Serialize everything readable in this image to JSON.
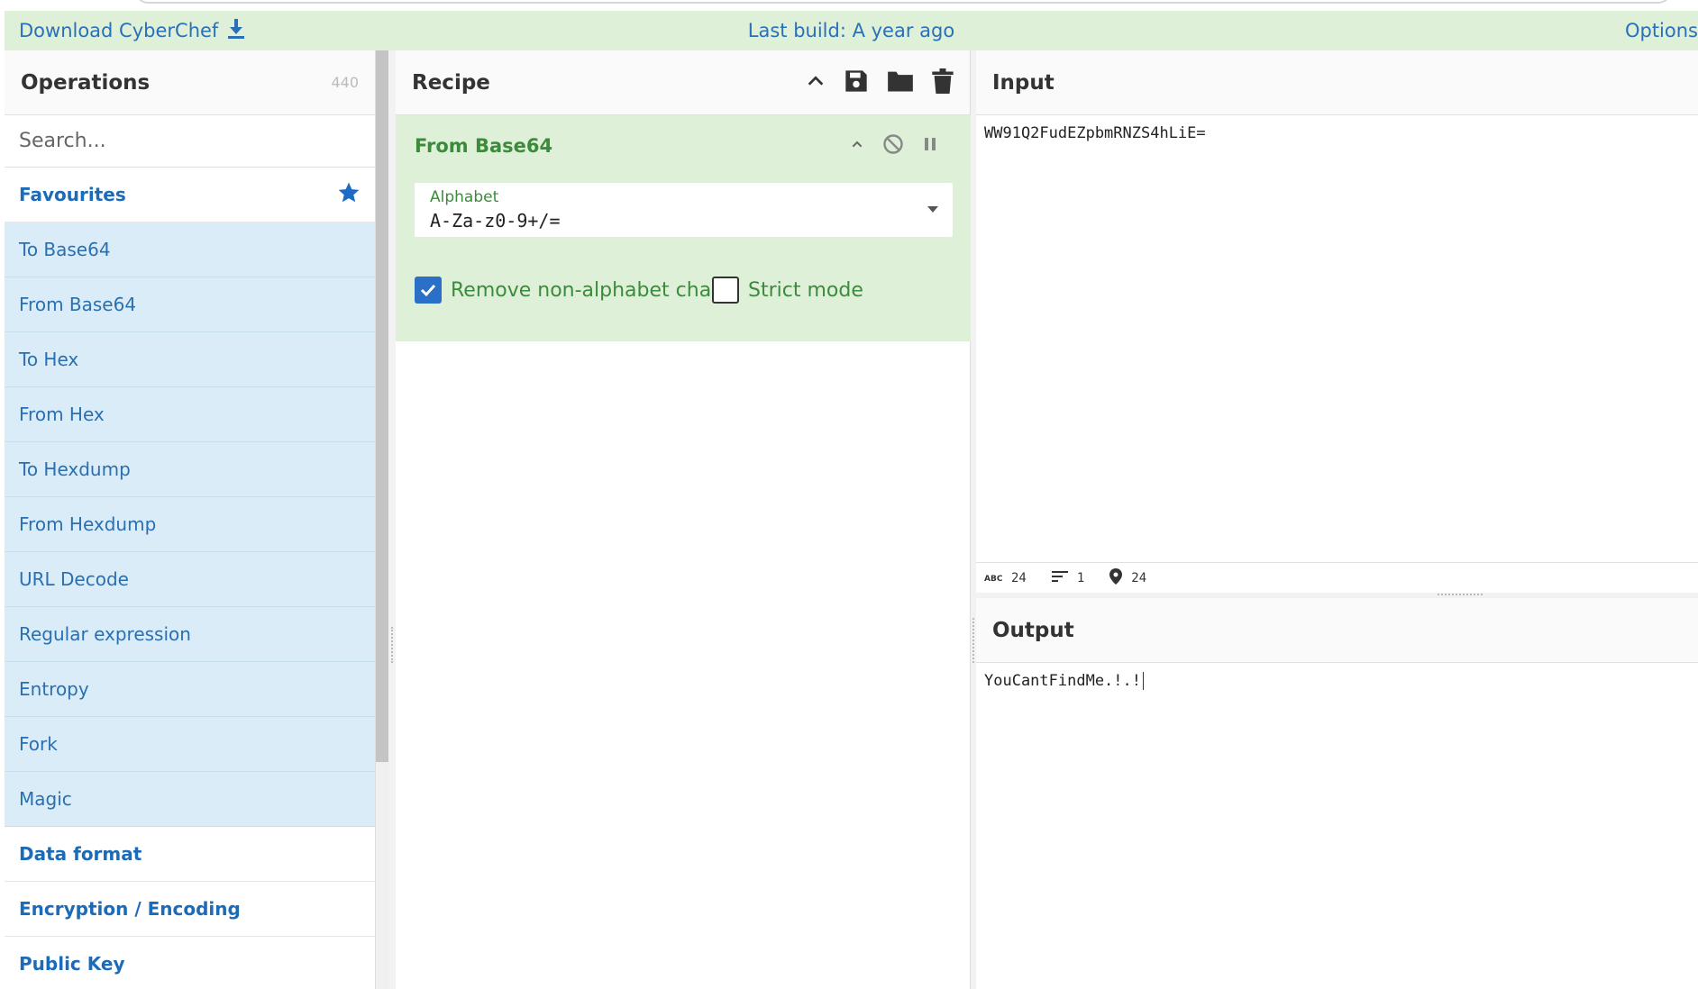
{
  "banner": {
    "download_label": "Download CyberChef",
    "last_build": "Last build: A year ago",
    "options_label": "Options"
  },
  "operations": {
    "title": "Operations",
    "count": "440",
    "search_placeholder": "Search...",
    "favourites_label": "Favourites",
    "favourites": [
      "To Base64",
      "From Base64",
      "To Hex",
      "From Hex",
      "To Hexdump",
      "From Hexdump",
      "URL Decode",
      "Regular expression",
      "Entropy",
      "Fork",
      "Magic"
    ],
    "categories": [
      "Data format",
      "Encryption / Encoding",
      "Public Key"
    ]
  },
  "recipe": {
    "title": "Recipe",
    "operation": {
      "name": "From Base64",
      "alphabet_label": "Alphabet",
      "alphabet_value": "A-Za-z0-9+/=",
      "remove_non_alphabet_label": "Remove non-alphabet chars",
      "remove_non_alphabet_checked": true,
      "strict_mode_label": "Strict mode",
      "strict_mode_checked": false
    }
  },
  "input": {
    "title": "Input",
    "text": "WW91Q2FudEZpbmRNZS4hLiE=",
    "stats": {
      "chars": "24",
      "lines": "1",
      "position": "24"
    }
  },
  "output": {
    "title": "Output",
    "text": "YouCantFindMe.!.!"
  },
  "colors": {
    "banner_bg": "#dff0d8",
    "link_blue": "#2a70b8",
    "favourite_bg": "#d9ecf7",
    "recipe_green": "#3c8b3c"
  }
}
